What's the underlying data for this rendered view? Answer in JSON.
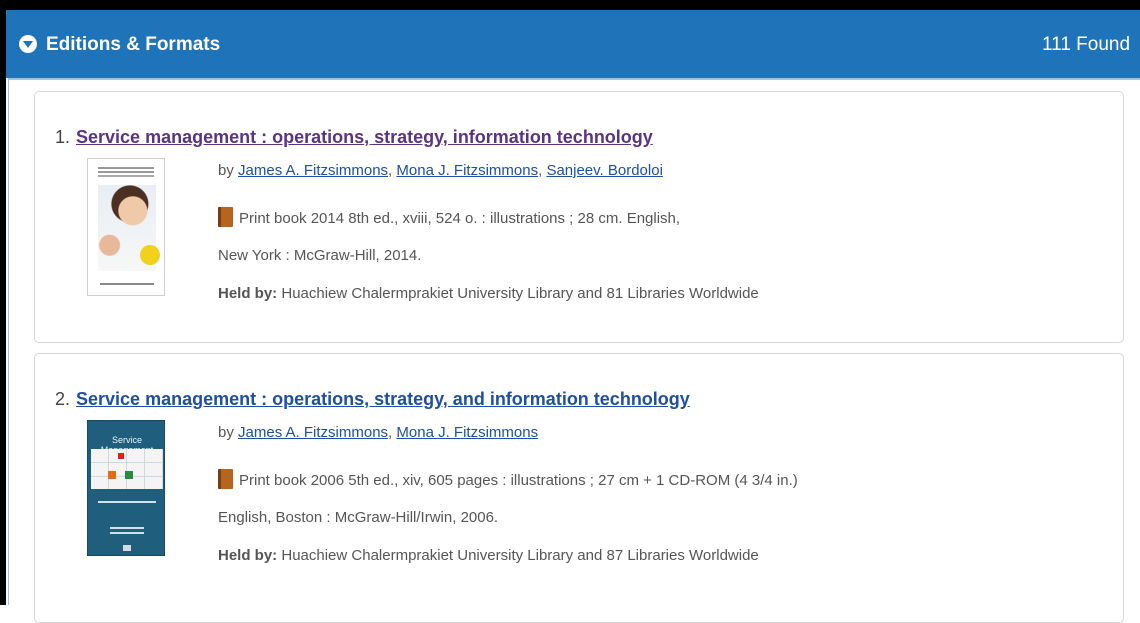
{
  "header": {
    "title": "Editions & Formats",
    "count": "111 Found"
  },
  "results": [
    {
      "number": "1.",
      "title": "Service management : operations, strategy, information technology",
      "by_prefix": "by",
      "authors": [
        "James A. Fitzsimmons",
        "Mona J. Fitzsimmons",
        "Sanjeev. Bordoloi"
      ],
      "format_line": "Print book 2014 8th ed., xviii, 524 o. : illustrations ; 28 cm. English,",
      "publisher_line": "New York : McGraw-Hill, 2014.",
      "held_label": "Held by:",
      "held_text": " Huachiew Chalermprakiet University Library and 81 Libraries Worldwide"
    },
    {
      "number": "2.",
      "title": "Service management : operations, strategy, and information technology",
      "by_prefix": "by",
      "authors": [
        "James A. Fitzsimmons",
        "Mona J. Fitzsimmons"
      ],
      "format_line": "Print book 2006 5th ed., xiv, 605 pages : illustrations ; 27 cm + 1 CD-ROM (4 3/4 in.)",
      "publisher_line": "English, Boston : McGraw-Hill/Irwin, 2006.",
      "held_label": "Held by:",
      "held_text": " Huachiew Chalermprakiet University Library and 87 Libraries Worldwide",
      "cover_title": "Service Management"
    }
  ],
  "colors": {
    "header_bg": "#1f74b9",
    "link": "#1f4fa0",
    "visited_link": "#5a3384",
    "icon_book": "#b5651d"
  },
  "icons": {
    "toggle": "chevron-down-circle-icon",
    "format": "book-icon"
  }
}
